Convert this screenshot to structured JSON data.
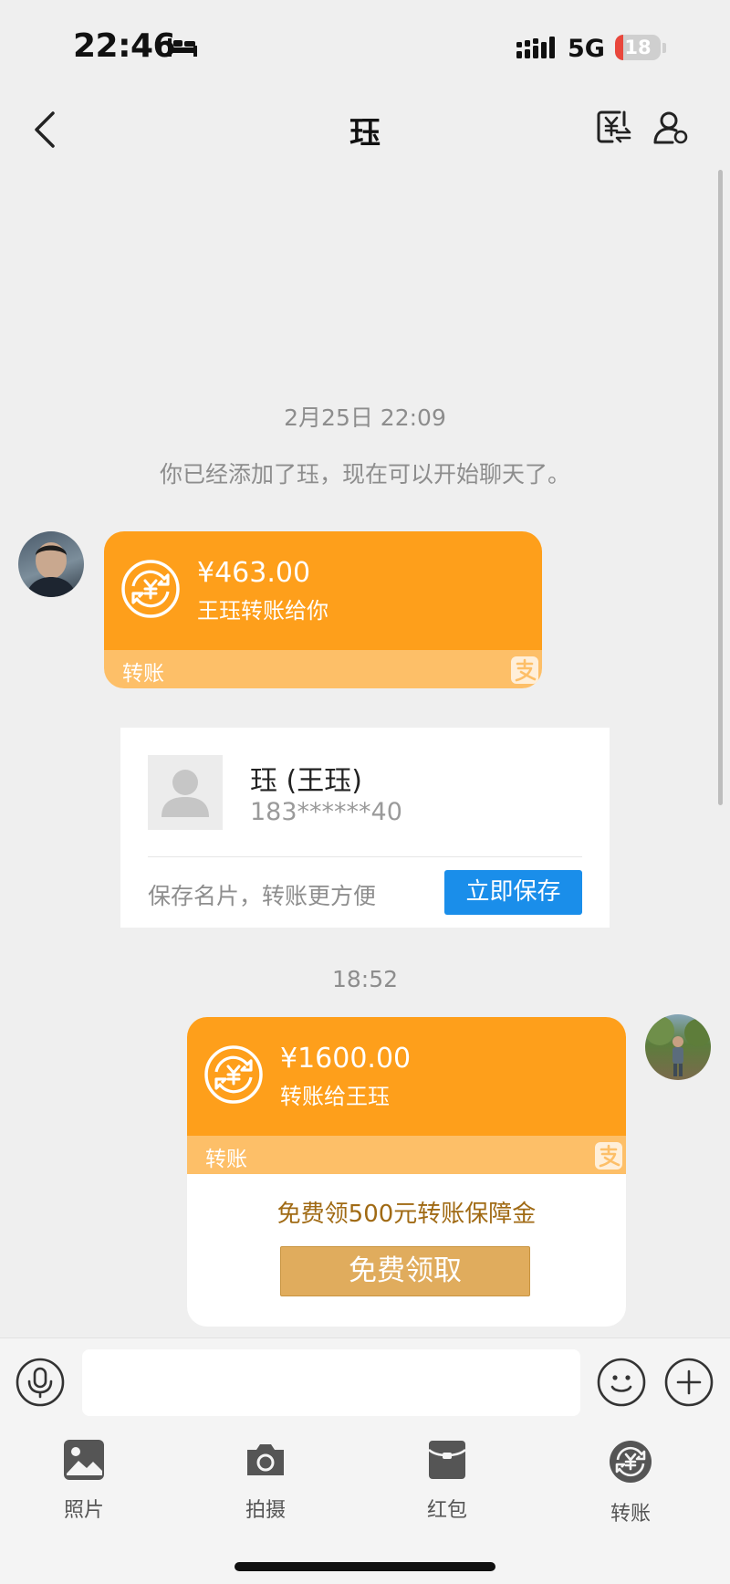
{
  "status_bar": {
    "time": "22:46",
    "network": "5G",
    "battery_level": "18",
    "battery_fraction": 0.18,
    "icons": [
      "bed-icon",
      "signal-icon",
      "battery-icon"
    ]
  },
  "nav": {
    "title": "珏",
    "icons": [
      "back-icon",
      "transfer-icon",
      "profile-icon"
    ]
  },
  "chat": {
    "date_label": "2月25日 22:09",
    "system_message": "你已经添加了珏，现在可以开始聊天了。",
    "time_label": "18:52",
    "incoming_transfer": {
      "amount": "¥463.00",
      "note": "王珏转账给你",
      "label": "转账",
      "icon": "yuan-transfer-icon",
      "alipay_icon": "alipay-icon"
    },
    "contact_card": {
      "name": "珏 (王珏)",
      "phone": "183******40",
      "hint": "保存名片，转账更方便",
      "button": "立即保存"
    },
    "outgoing_transfer": {
      "amount": "¥1600.00",
      "note": "转账给王珏",
      "label": "转账",
      "promo": "免费领500元转账保障金",
      "button": "免费领取",
      "icon": "yuan-transfer-icon",
      "alipay_icon": "alipay-icon"
    }
  },
  "input_bar": {
    "placeholder": "",
    "icons": [
      "microphone-icon",
      "emoji-icon",
      "plus-icon"
    ]
  },
  "toolbar": {
    "items": [
      {
        "label": "照片",
        "icon": "photo-icon"
      },
      {
        "label": "拍摄",
        "icon": "camera-icon"
      },
      {
        "label": "红包",
        "icon": "red-packet-icon"
      },
      {
        "label": "转账",
        "icon": "transfer-icon"
      }
    ]
  },
  "colors": {
    "transfer_orange": "#fe9f1b",
    "transfer_light": "#fdbf68",
    "save_blue": "#1a8eea",
    "claim_gold": "#e0ac5d",
    "background": "#efefef"
  }
}
